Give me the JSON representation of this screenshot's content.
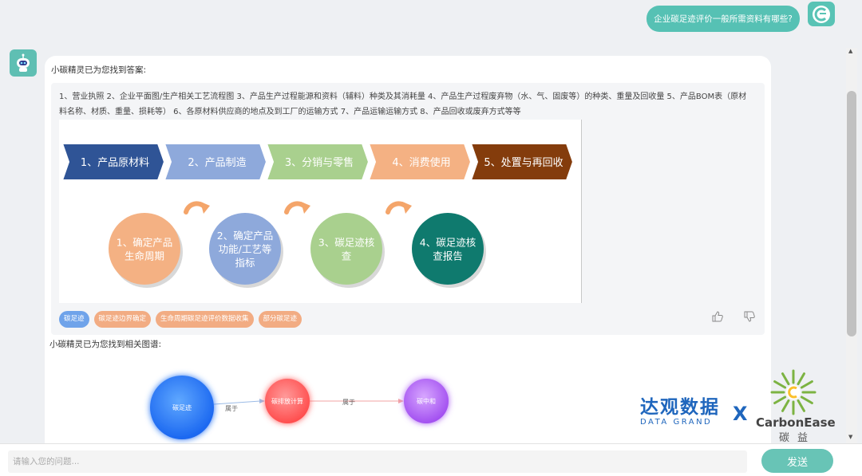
{
  "user_message": "企业碳足迹评价一般所需资料有哪些?",
  "answer": {
    "intro": "小碳精灵已为您找到答案:",
    "text": "1、营业执照   2、企业平面图/生产相关工艺流程图   3、产品生产过程能源和资料（辅料）种类及其消耗量   4、产品生产过程废弃物（水、气、固废等）的种类、重量及回收量   5、产品BOM表（原材料名称、材质、重量、损耗等）   6、各原材料供应商的地点及到工厂的运输方式   7、产品运输运输方式   8、产品回收或废弃方式等等",
    "diagram": {
      "stages": [
        "1、产品原材料",
        "2、产品制造",
        "3、分销与零售",
        "4、消费使用",
        "5、处置与再回收"
      ],
      "steps": [
        [
          "1、确定产品",
          "生命周期"
        ],
        [
          "2、确定产品",
          "功能/工艺等",
          "指标"
        ],
        [
          "3、碳足迹核",
          "查"
        ],
        [
          "4、碳足迹核",
          "查报告"
        ]
      ],
      "stage_colors": [
        "#2f5496",
        "#8ea9db",
        "#a9d08e",
        "#f4b183",
        "#843c0c"
      ],
      "step_colors": [
        "#f4b183",
        "#8ea9db",
        "#a9d08e",
        "#0f7a6e"
      ]
    },
    "tags": [
      "碳足迹",
      "碳足迹边界确定",
      "生命周期碳足迹评价数据收集",
      "部分碳足迹"
    ]
  },
  "graph": {
    "intro": "小碳精灵已为您找到相关图谱:",
    "nodes": [
      "碳足迹",
      "碳排放计算",
      "碳中和"
    ],
    "edges": [
      "属于",
      "属于"
    ]
  },
  "input": {
    "placeholder": "请输入您的问题..."
  },
  "send_label": "发送",
  "logos": {
    "dg_cn": "达观数据",
    "dg_en": "DATA GRAND",
    "x": "X",
    "ce_name": "CarbonEase",
    "ce_cn": "碳益"
  }
}
